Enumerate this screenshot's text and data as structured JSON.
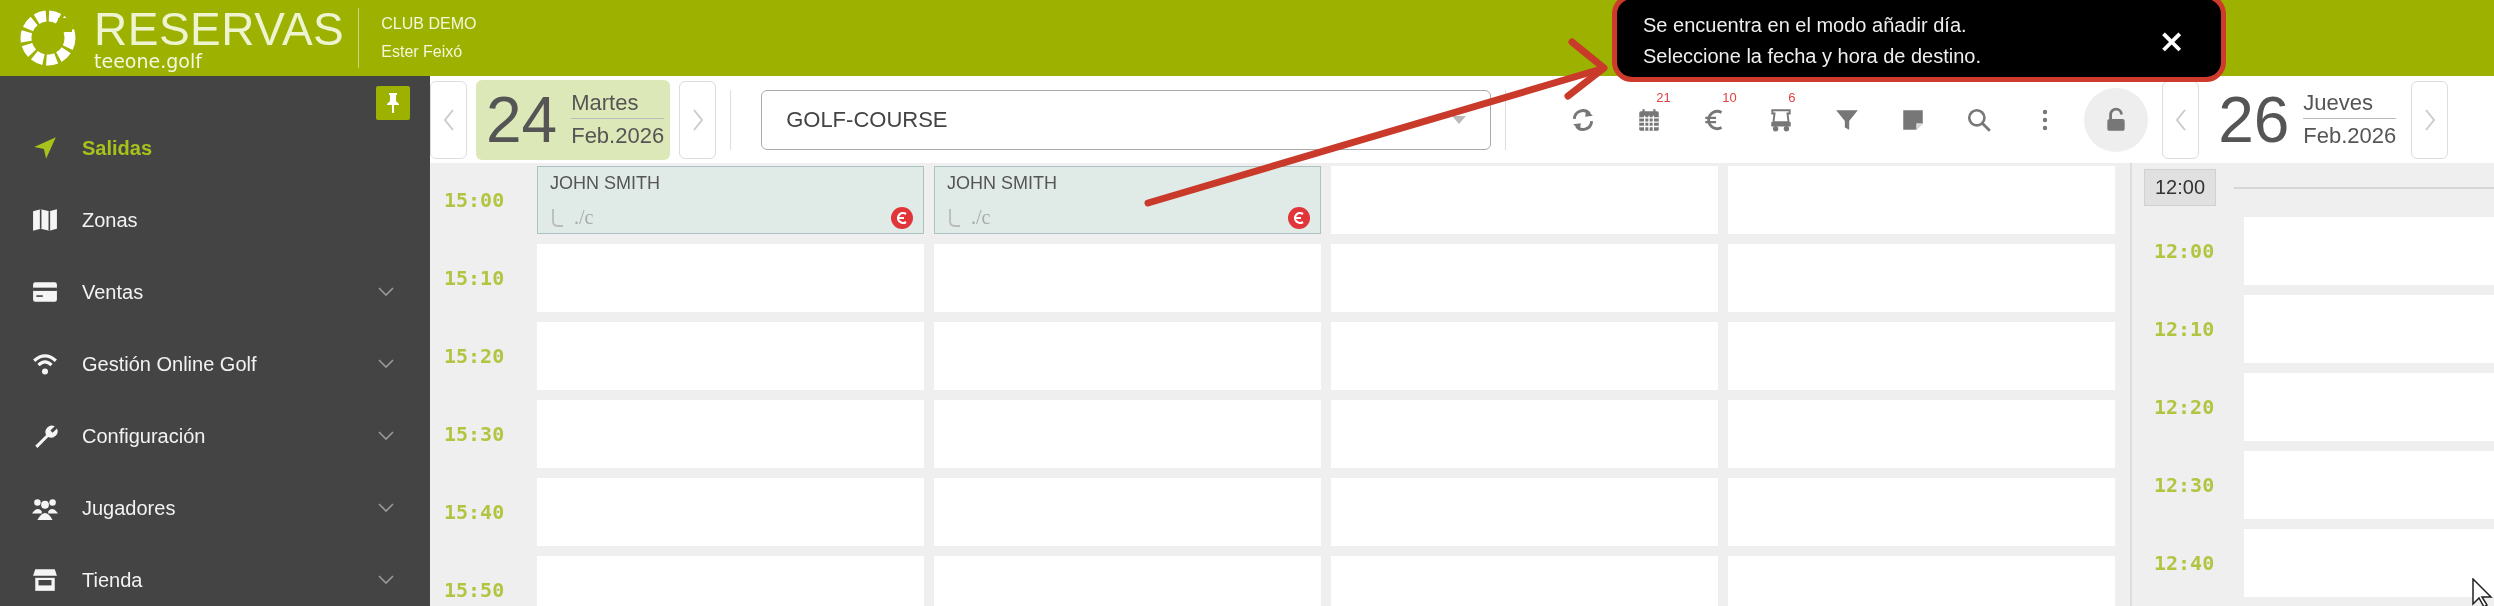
{
  "header": {
    "logo_title": "RESERVAS",
    "logo_subtitle": "teeone.golf",
    "club": "CLUB DEMO",
    "user": "Ester Feixó"
  },
  "notice": {
    "lines": [
      "Se encuentra en el modo añadir día.",
      "Seleccione la fecha y hora de destino."
    ],
    "close": "×"
  },
  "sidebar": {
    "items": [
      {
        "label": "Salidas",
        "selected": true,
        "expandable": false
      },
      {
        "label": "Zonas",
        "selected": false,
        "expandable": false
      },
      {
        "label": "Ventas",
        "selected": false,
        "expandable": true
      },
      {
        "label": "Gestión Online Golf",
        "selected": false,
        "expandable": true
      },
      {
        "label": "Configuración",
        "selected": false,
        "expandable": true
      },
      {
        "label": "Jugadores",
        "selected": false,
        "expandable": true
      },
      {
        "label": "Tienda",
        "selected": false,
        "expandable": true
      }
    ]
  },
  "date_left": {
    "day": "24",
    "weekday": "Martes",
    "month": "Feb.2026",
    "selected": true
  },
  "course_select": {
    "value": "GOLF-COURSE"
  },
  "tools": [
    {
      "kind": "refresh"
    },
    {
      "kind": "calendar",
      "badge": "21"
    },
    {
      "kind": "euro",
      "badge": "10"
    },
    {
      "kind": "cart",
      "badge": "6"
    },
    {
      "kind": "filter"
    },
    {
      "kind": "note"
    },
    {
      "kind": "search"
    },
    {
      "kind": "more"
    },
    {
      "kind": "lock"
    }
  ],
  "date_right": {
    "day": "26",
    "weekday": "Jueves",
    "month": "Feb.2026",
    "selected": false
  },
  "grid": {
    "rows": [
      {
        "time": "15:00",
        "cells": [
          {
            "kind": "booking",
            "name": "JOHN SMITH",
            "note": "./c",
            "unpaid": true
          },
          {
            "kind": "booking",
            "name": "JOHN SMITH",
            "note": "./c",
            "unpaid": true
          },
          {
            "kind": "empty"
          },
          {
            "kind": "empty"
          }
        ]
      },
      {
        "time": "15:10",
        "cells": [
          {
            "kind": "empty"
          },
          {
            "kind": "empty"
          },
          {
            "kind": "empty"
          },
          {
            "kind": "empty"
          }
        ]
      },
      {
        "time": "15:20",
        "cells": [
          {
            "kind": "empty"
          },
          {
            "kind": "empty"
          },
          {
            "kind": "empty"
          },
          {
            "kind": "empty"
          }
        ]
      },
      {
        "time": "15:30",
        "cells": [
          {
            "kind": "empty"
          },
          {
            "kind": "empty"
          },
          {
            "kind": "empty"
          },
          {
            "kind": "empty"
          }
        ]
      },
      {
        "time": "15:40",
        "cells": [
          {
            "kind": "empty"
          },
          {
            "kind": "empty"
          },
          {
            "kind": "empty"
          },
          {
            "kind": "empty"
          }
        ]
      },
      {
        "time": "15:50",
        "cells": [
          {
            "kind": "empty"
          },
          {
            "kind": "empty"
          },
          {
            "kind": "empty"
          },
          {
            "kind": "empty"
          }
        ]
      }
    ]
  },
  "right_panel": {
    "hour_chip": "12:00",
    "rows": [
      {
        "time": "12:00"
      },
      {
        "time": "12:10"
      },
      {
        "time": "12:20"
      },
      {
        "time": "12:30"
      },
      {
        "time": "12:40"
      }
    ]
  }
}
